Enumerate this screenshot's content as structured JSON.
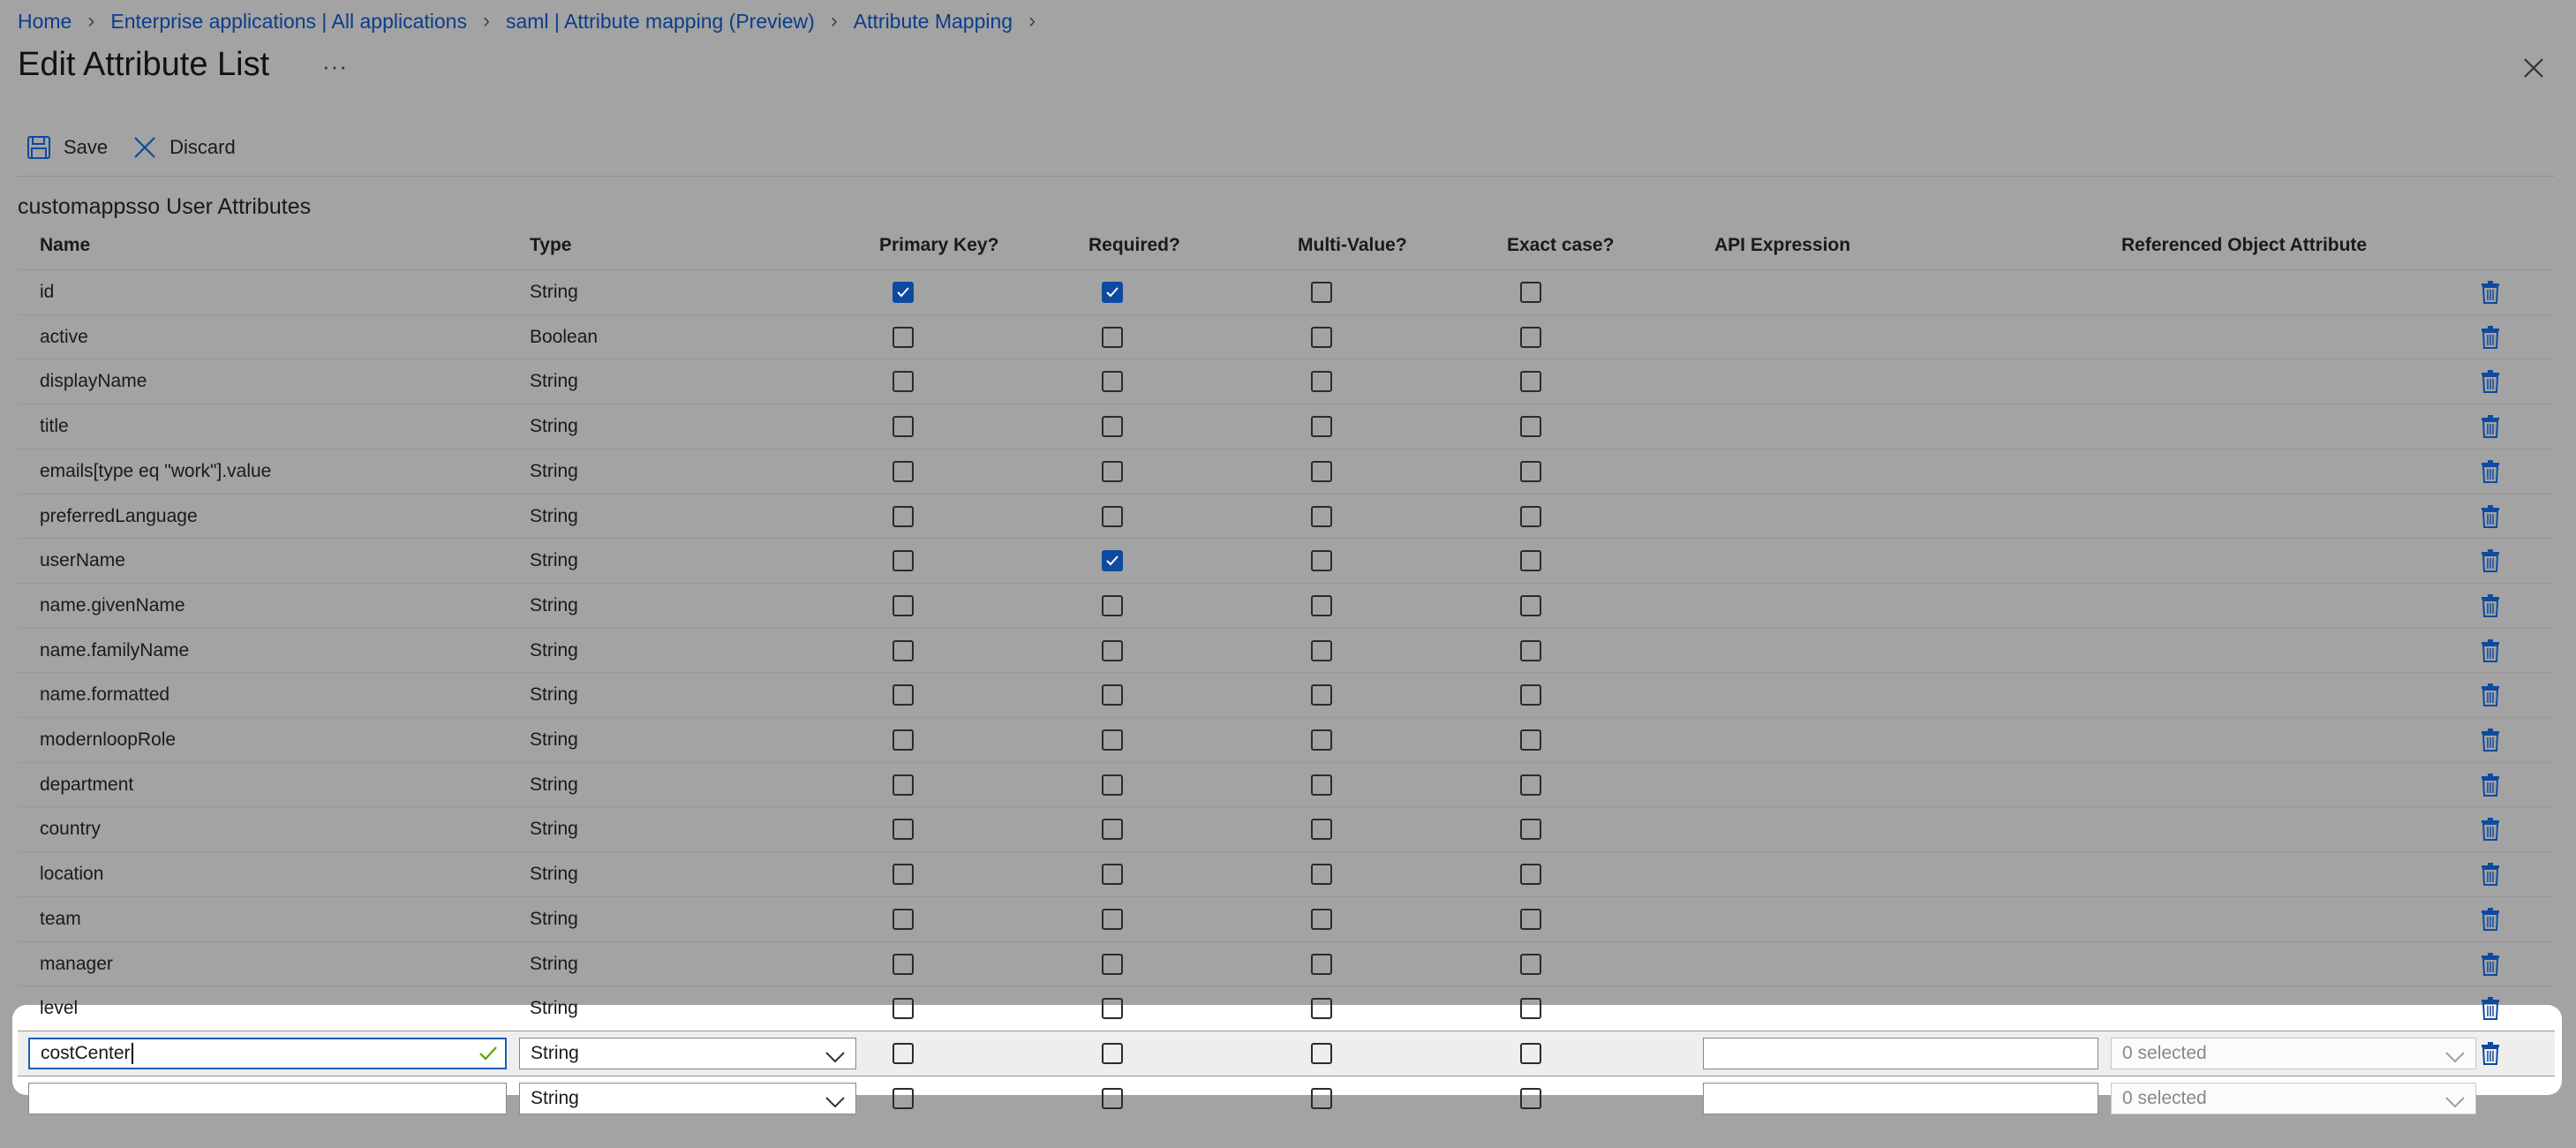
{
  "breadcrumb": [
    "Home",
    "Enterprise applications | All applications",
    "saml | Attribute mapping (Preview)",
    "Attribute Mapping"
  ],
  "title": "Edit Attribute List",
  "more_label": "···",
  "toolbar": {
    "save_label": "Save",
    "discard_label": "Discard"
  },
  "section_title": "customappsso User Attributes",
  "columns": [
    "Name",
    "Type",
    "Primary Key?",
    "Required?",
    "Multi-Value?",
    "Exact case?",
    "API Expression",
    "Referenced Object Attribute"
  ],
  "rows": [
    {
      "name": "id",
      "type": "String",
      "primary": true,
      "required": true,
      "multi": false,
      "exact": false
    },
    {
      "name": "active",
      "type": "Boolean",
      "primary": false,
      "required": false,
      "multi": false,
      "exact": false
    },
    {
      "name": "displayName",
      "type": "String",
      "primary": false,
      "required": false,
      "multi": false,
      "exact": false
    },
    {
      "name": "title",
      "type": "String",
      "primary": false,
      "required": false,
      "multi": false,
      "exact": false
    },
    {
      "name": "emails[type eq \"work\"].value",
      "type": "String",
      "primary": false,
      "required": false,
      "multi": false,
      "exact": false
    },
    {
      "name": "preferredLanguage",
      "type": "String",
      "primary": false,
      "required": false,
      "multi": false,
      "exact": false
    },
    {
      "name": "userName",
      "type": "String",
      "primary": false,
      "required": true,
      "multi": false,
      "exact": false
    },
    {
      "name": "name.givenName",
      "type": "String",
      "primary": false,
      "required": false,
      "multi": false,
      "exact": false
    },
    {
      "name": "name.familyName",
      "type": "String",
      "primary": false,
      "required": false,
      "multi": false,
      "exact": false
    },
    {
      "name": "name.formatted",
      "type": "String",
      "primary": false,
      "required": false,
      "multi": false,
      "exact": false
    },
    {
      "name": "modernloopRole",
      "type": "String",
      "primary": false,
      "required": false,
      "multi": false,
      "exact": false
    },
    {
      "name": "department",
      "type": "String",
      "primary": false,
      "required": false,
      "multi": false,
      "exact": false
    },
    {
      "name": "country",
      "type": "String",
      "primary": false,
      "required": false,
      "multi": false,
      "exact": false
    },
    {
      "name": "location",
      "type": "String",
      "primary": false,
      "required": false,
      "multi": false,
      "exact": false
    },
    {
      "name": "team",
      "type": "String",
      "primary": false,
      "required": false,
      "multi": false,
      "exact": false
    },
    {
      "name": "manager",
      "type": "String",
      "primary": false,
      "required": false,
      "multi": false,
      "exact": false
    },
    {
      "name": "level",
      "type": "String",
      "primary": false,
      "required": false,
      "multi": false,
      "exact": false
    }
  ],
  "edit_rows": [
    {
      "name_value": "costCenter",
      "type_value": "String",
      "api_value": "",
      "ref_value": "0 selected",
      "primary": false,
      "required": false,
      "multi": false,
      "exact": false
    },
    {
      "name_value": "",
      "type_value": "String",
      "api_value": "",
      "ref_value": "0 selected",
      "primary": false,
      "required": false,
      "multi": false,
      "exact": false
    }
  ],
  "colors": {
    "accent": "#0e4aa0",
    "link": "#0b3d8a",
    "overlay": "#a3a3a3",
    "focus": "#1d5bb5",
    "valid": "#57a300"
  },
  "icons": {
    "save": "save-icon",
    "discard": "discard-icon",
    "close": "close-icon",
    "delete": "trash-icon",
    "chevron": "chevron-down-icon",
    "check": "checkmark-icon"
  }
}
